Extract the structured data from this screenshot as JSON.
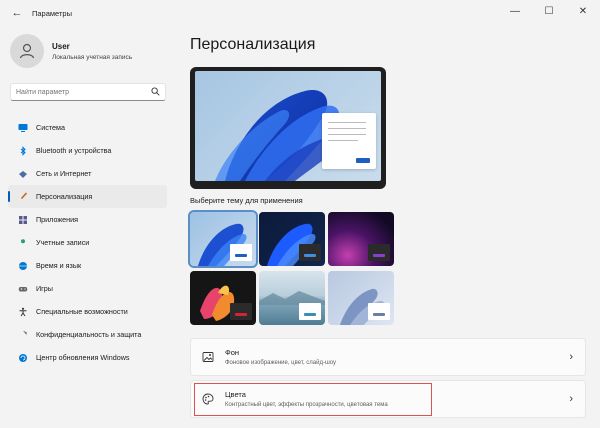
{
  "window": {
    "title": "Параметры",
    "back_glyph": "←",
    "minimize_glyph": "—",
    "maximize_glyph": "☐",
    "close_glyph": "✕"
  },
  "user": {
    "name": "User",
    "account": "Локальная учетная запись"
  },
  "search": {
    "placeholder": "Найти параметр"
  },
  "sidebar": {
    "items": [
      {
        "label": "Система",
        "icon": "monitor-icon",
        "color": "#0078d4"
      },
      {
        "label": "Bluetooth и устройства",
        "icon": "bluetooth-icon",
        "color": "#0078d4"
      },
      {
        "label": "Сеть и Интернет",
        "icon": "wifi-icon",
        "color": "#4a6fa5"
      },
      {
        "label": "Персонализация",
        "icon": "brush-icon",
        "color": "#c8641e",
        "active": true
      },
      {
        "label": "Приложения",
        "icon": "apps-icon",
        "color": "#5a5a8c"
      },
      {
        "label": "Учетные записи",
        "icon": "person-icon",
        "color": "#27a06e"
      },
      {
        "label": "Время и язык",
        "icon": "globe-icon",
        "color": "#0078d4"
      },
      {
        "label": "Игры",
        "icon": "gamepad-icon",
        "color": "#666666"
      },
      {
        "label": "Специальные возможности",
        "icon": "accessibility-icon",
        "color": "#333333"
      },
      {
        "label": "Конфиденциальность и защита",
        "icon": "shield-icon",
        "color": "#5a6a7a"
      },
      {
        "label": "Центр обновления Windows",
        "icon": "update-icon",
        "color": "#0078d4"
      }
    ]
  },
  "main": {
    "title": "Персонализация",
    "themes_label": "Выберите тему для применения",
    "cards": [
      {
        "title": "Фон",
        "subtitle": "Фоновое изображение, цвет, слайд-шоу",
        "icon": "image-icon"
      },
      {
        "title": "Цвета",
        "subtitle": "Контрастный цвет, эффекты прозрачности, цветовая тема",
        "icon": "palette-icon"
      }
    ],
    "chevron": "›"
  },
  "colors": {
    "accent": "#005fb8",
    "highlight_box": "#d9534f"
  }
}
